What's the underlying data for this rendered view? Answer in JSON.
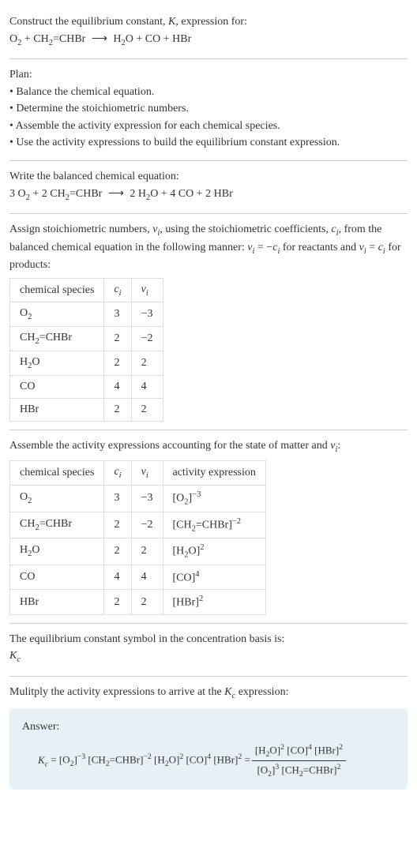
{
  "header": {
    "line1": "Construct the equilibrium constant, K, expression for:",
    "equation": "O₂ + CH₂=CHBr ⟶ H₂O + CO + HBr"
  },
  "plan": {
    "title": "Plan:",
    "items": [
      "• Balance the chemical equation.",
      "• Determine the stoichiometric numbers.",
      "• Assemble the activity expression for each chemical species.",
      "• Use the activity expressions to build the equilibrium constant expression."
    ]
  },
  "balanced": {
    "title": "Write the balanced chemical equation:",
    "equation": "3 O₂ + 2 CH₂=CHBr ⟶ 2 H₂O + 4 CO + 2 HBr"
  },
  "stoich": {
    "intro": "Assign stoichiometric numbers, νᵢ, using the stoichiometric coefficients, cᵢ, from the balanced chemical equation in the following manner: νᵢ = −cᵢ for reactants and νᵢ = cᵢ for products:",
    "headers": [
      "chemical species",
      "cᵢ",
      "νᵢ"
    ],
    "rows": [
      [
        "O₂",
        "3",
        "−3"
      ],
      [
        "CH₂=CHBr",
        "2",
        "−2"
      ],
      [
        "H₂O",
        "2",
        "2"
      ],
      [
        "CO",
        "4",
        "4"
      ],
      [
        "HBr",
        "2",
        "2"
      ]
    ]
  },
  "activity": {
    "intro": "Assemble the activity expressions accounting for the state of matter and νᵢ:",
    "headers": [
      "chemical species",
      "cᵢ",
      "νᵢ",
      "activity expression"
    ],
    "rows": [
      [
        "O₂",
        "3",
        "−3",
        "[O₂]⁻³"
      ],
      [
        "CH₂=CHBr",
        "2",
        "−2",
        "[CH₂=CHBr]⁻²"
      ],
      [
        "H₂O",
        "2",
        "2",
        "[H₂O]²"
      ],
      [
        "CO",
        "4",
        "4",
        "[CO]⁴"
      ],
      [
        "HBr",
        "2",
        "2",
        "[HBr]²"
      ]
    ]
  },
  "symbol": {
    "line1": "The equilibrium constant symbol in the concentration basis is:",
    "line2": "K꜀"
  },
  "multiply": {
    "title": "Mulitply the activity expressions to arrive at the K꜀ expression:"
  },
  "answer": {
    "label": "Answer:",
    "lhs": "K꜀ = [O₂]⁻³ [CH₂=CHBr]⁻² [H₂O]² [CO]⁴ [HBr]² = ",
    "numerator": "[H₂O]² [CO]⁴ [HBr]²",
    "denominator": "[O₂]³ [CH₂=CHBr]²"
  }
}
